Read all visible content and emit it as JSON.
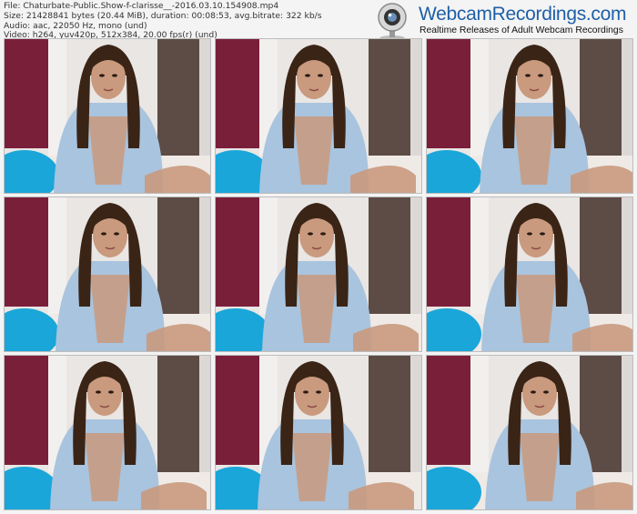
{
  "info_lines": [
    "File: Chaturbate-Public.Show-f-clarisse__-2016.03.10.154908.mp4",
    "Size: 21428841 bytes (20.44 MiB), duration: 00:08:53, avg.bitrate: 322 kb/s",
    "Audio: aac, 22050 Hz, mono (und)",
    "Video: h264, yuv420p, 512x384, 20.00 fps(r) (und)"
  ],
  "brand": {
    "name": "WebcamRecordings.com",
    "tagline": "Realtime Releases of Adult Webcam Recordings",
    "icon": "webcam-icon"
  },
  "thumbnails": [
    {
      "id": 1
    },
    {
      "id": 2
    },
    {
      "id": 3
    },
    {
      "id": 4
    },
    {
      "id": 5
    },
    {
      "id": 6
    },
    {
      "id": 7
    },
    {
      "id": 8
    },
    {
      "id": 9
    }
  ],
  "colors": {
    "wall_left": "#7a1f3a",
    "wall_right": "#5d4b45",
    "ball": "#1aa6d9",
    "jacket": "#a9c4de",
    "hair": "#3a2416",
    "skin": "#c99a7e",
    "brand_blue": "#1f5fa8"
  }
}
